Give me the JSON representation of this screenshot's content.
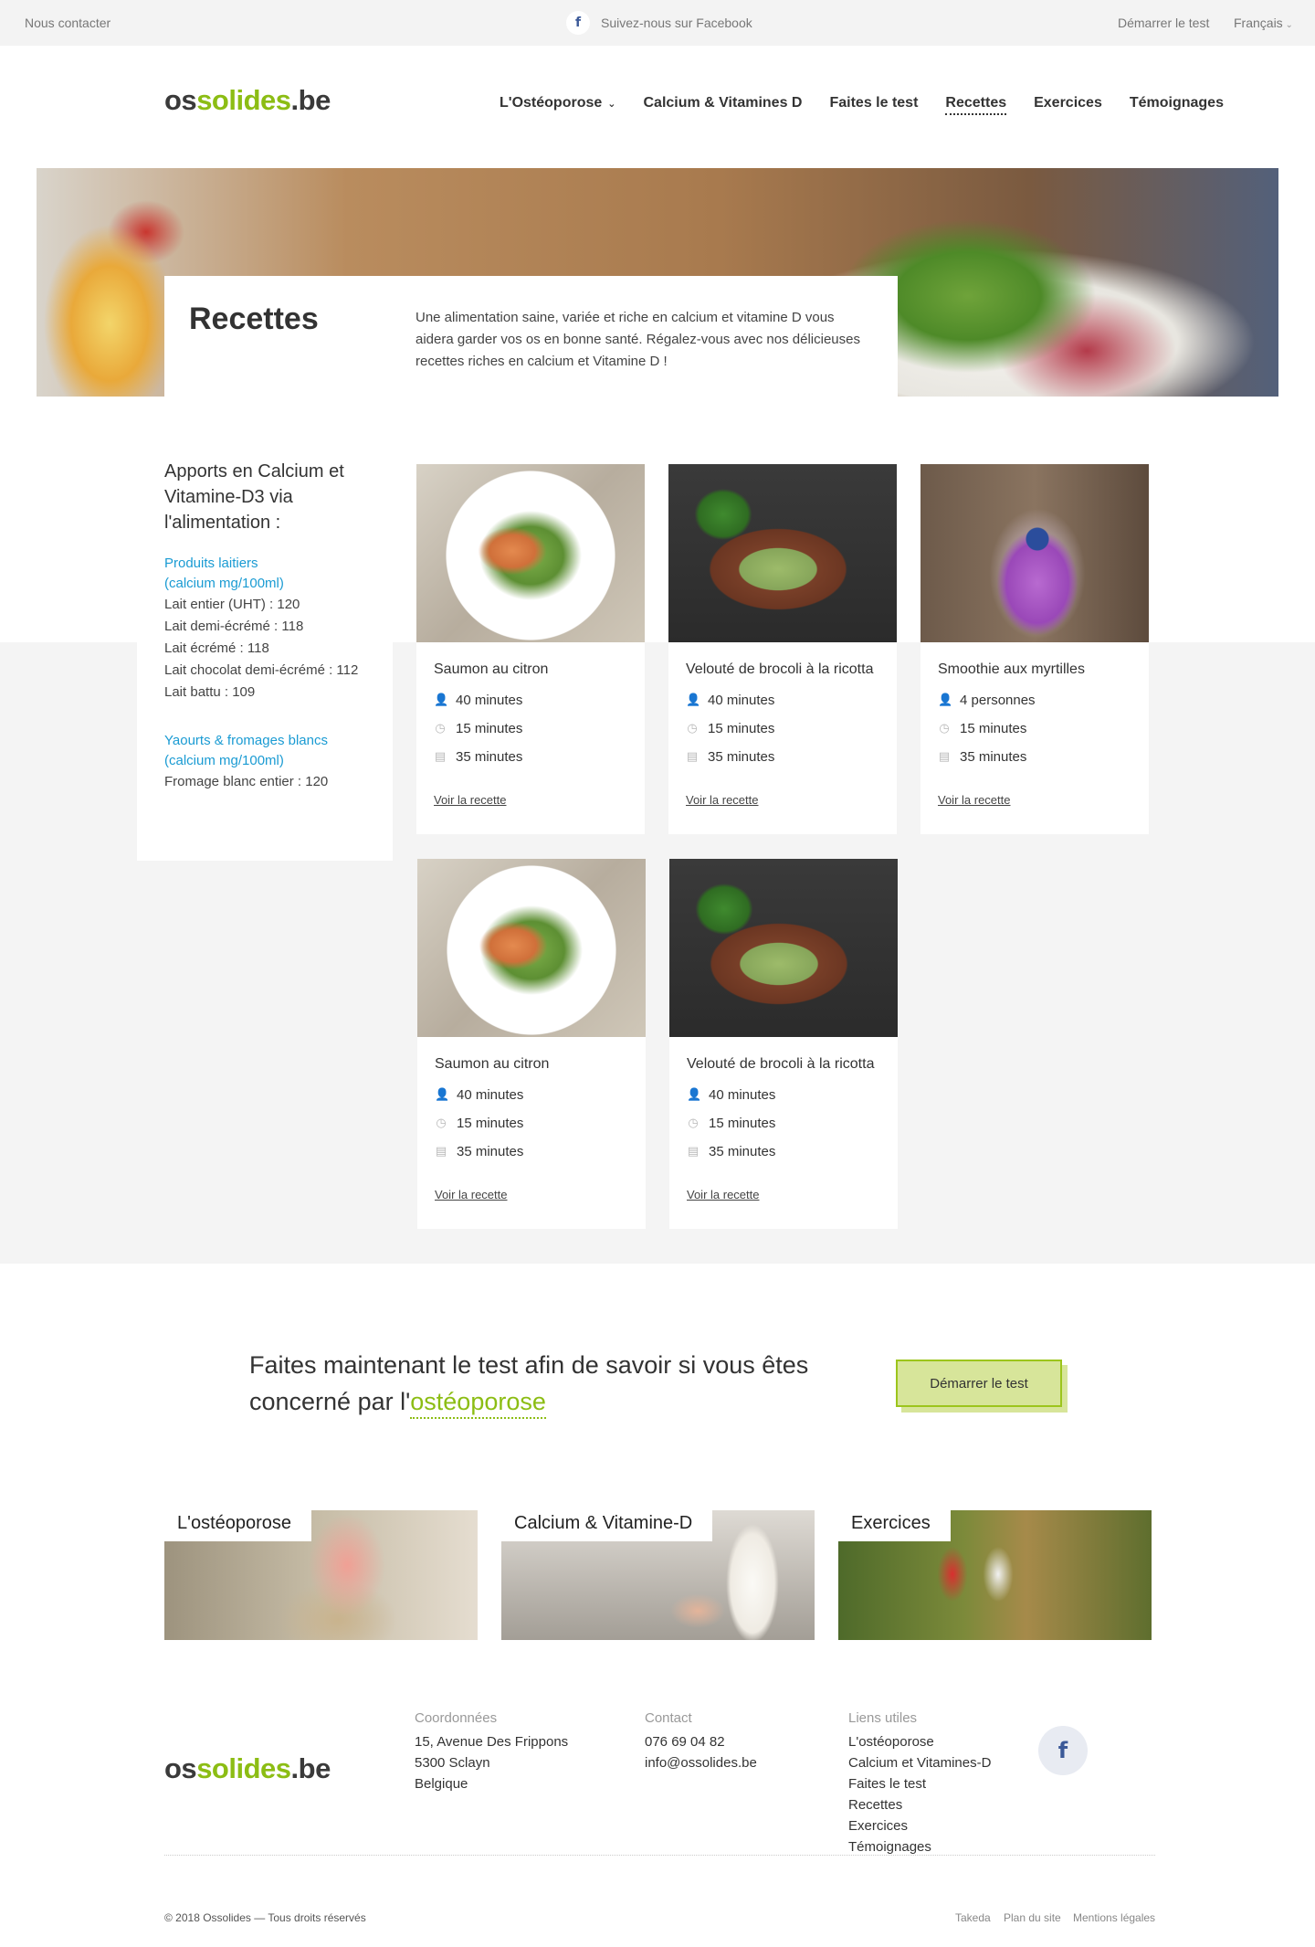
{
  "topbar": {
    "contact": "Nous contacter",
    "facebook": "Suivez-nous sur Facebook",
    "start_test": "Démarrer le test",
    "language": "Français"
  },
  "header": {
    "logo_part1": "os",
    "logo_part2": "solides",
    "logo_part3": ".be",
    "nav": [
      "L'Ostéoporose",
      "Calcium & Vitamines D",
      "Faites le test",
      "Recettes",
      "Exercices",
      "Témoignages"
    ]
  },
  "hero": {
    "title": "Recettes",
    "text": "Une alimentation saine, variée et riche en calcium et vitamine D vous aidera garder vos os en bonne santé. Régalez-vous avec nos délicieuses recettes riches en calcium et Vitamine D !"
  },
  "sidebar": {
    "title": "Apports en Calcium et Vitamine-D3 via l'alimentation :",
    "group1_title_a": "Produits laitiers",
    "group1_title_b": "(calcium mg/100ml)",
    "group1_items": [
      "Lait entier (UHT) : 120",
      "Lait demi-écrémé : 118",
      "Lait écrémé : 118",
      "Lait chocolat demi-écrémé : 112",
      "Lait battu : 109"
    ],
    "group2_title_a": "Yaourts & fromages blancs",
    "group2_title_b": "(calcium mg/100ml)",
    "group2_items": [
      "Fromage blanc entier : 120"
    ]
  },
  "recipes": [
    {
      "title": "Saumon au citron",
      "people": "40 minutes",
      "prep": "15 minutes",
      "cook": "35 minutes",
      "link": "Voir la recette"
    },
    {
      "title": "Velouté de brocoli à la ricotta",
      "people": "40 minutes",
      "prep": "15 minutes",
      "cook": "35 minutes",
      "link": "Voir la recette"
    },
    {
      "title": "Smoothie aux myrtilles",
      "people": "4 personnes",
      "prep": "15 minutes",
      "cook": "35 minutes",
      "link": "Voir la recette"
    },
    {
      "title": "Saumon au citron",
      "people": "40 minutes",
      "prep": "15 minutes",
      "cook": "35 minutes",
      "link": "Voir la recette"
    },
    {
      "title": "Velouté de brocoli à la ricotta",
      "people": "40 minutes",
      "prep": "15 minutes",
      "cook": "35 minutes",
      "link": "Voir la recette"
    }
  ],
  "cta": {
    "text_a": "Faites maintenant le test afin de savoir si vous êtes concerné par l'",
    "text_highlight": "ostéoporose",
    "button": "Démarrer le test"
  },
  "tiles": [
    "L'ostéoporose",
    "Calcium & Vitamine-D",
    "Exercices"
  ],
  "footer": {
    "coord_title": "Coordonnées",
    "coord_lines": [
      "15, Avenue Des Frippons",
      "5300 Sclayn",
      "Belgique"
    ],
    "contact_title": "Contact",
    "contact_lines": [
      "076 69 04 82",
      "info@ossolides.be"
    ],
    "links_title": "Liens utiles",
    "links": [
      "L'ostéoporose",
      "Calcium et Vitamines-D",
      "Faites le test",
      "Recettes",
      "Exercices",
      "Témoignages"
    ],
    "copyright": "© 2018 Ossolides — Tous droits réservés",
    "bottom_links": [
      "Takeda",
      "Plan du site",
      "Mentions légales"
    ]
  },
  "icons": {
    "facebook": "facebook-icon",
    "people": "person-icon",
    "prep": "clock-icon",
    "cook": "pot-icon",
    "dropdown": "chevron-down-icon"
  },
  "colors": {
    "brand_green": "#8cbd14",
    "link_blue": "#1a9bd3",
    "cta_bg": "#d7e59a",
    "facebook_blue": "#3b5998"
  }
}
